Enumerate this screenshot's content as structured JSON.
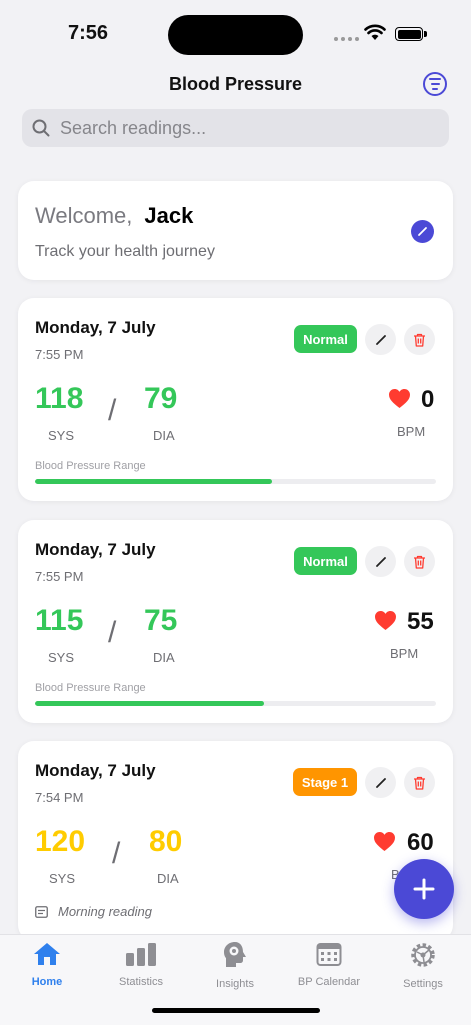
{
  "status_bar": {
    "time": "7:56"
  },
  "header": {
    "title": "Blood Pressure"
  },
  "search": {
    "placeholder": "Search readings..."
  },
  "welcome": {
    "greeting": "Welcome,",
    "name": "Jack",
    "subtitle": "Track your health journey"
  },
  "range_label": "Blood Pressure Range",
  "readings": [
    {
      "date": "Monday, 7 July",
      "time": "7:55 PM",
      "status": "Normal",
      "sys": "118",
      "dia": "79",
      "sys_label": "SYS",
      "dia_label": "DIA",
      "bpm": "0",
      "bpm_label": "BPM",
      "range_percent": 59
    },
    {
      "date": "Monday, 7 July",
      "time": "7:55 PM",
      "status": "Normal",
      "sys": "115",
      "dia": "75",
      "sys_label": "SYS",
      "dia_label": "DIA",
      "bpm": "55",
      "bpm_label": "BPM",
      "range_percent": 57
    },
    {
      "date": "Monday, 7 July",
      "time": "7:54 PM",
      "status": "Stage 1",
      "sys": "120",
      "dia": "80",
      "sys_label": "SYS",
      "dia_label": "DIA",
      "bpm": "60",
      "bpm_label": "B",
      "note": "Morning reading"
    }
  ],
  "colors": {
    "accent": "#4b49d6",
    "normal": "#34c759",
    "stage1": "#ff9500",
    "stage1_values": "#ffcc00",
    "heart": "#ff3b30",
    "tab_active": "#2f80ed"
  },
  "tabs": [
    {
      "label": "Home",
      "icon": "house-icon",
      "active": true
    },
    {
      "label": "Statistics",
      "icon": "bar-chart-icon",
      "active": false
    },
    {
      "label": "Insights",
      "icon": "brain-head-icon",
      "active": false
    },
    {
      "label": "BP Calendar",
      "icon": "calendar-icon",
      "active": false
    },
    {
      "label": "Settings",
      "icon": "gear-icon",
      "active": false
    }
  ]
}
